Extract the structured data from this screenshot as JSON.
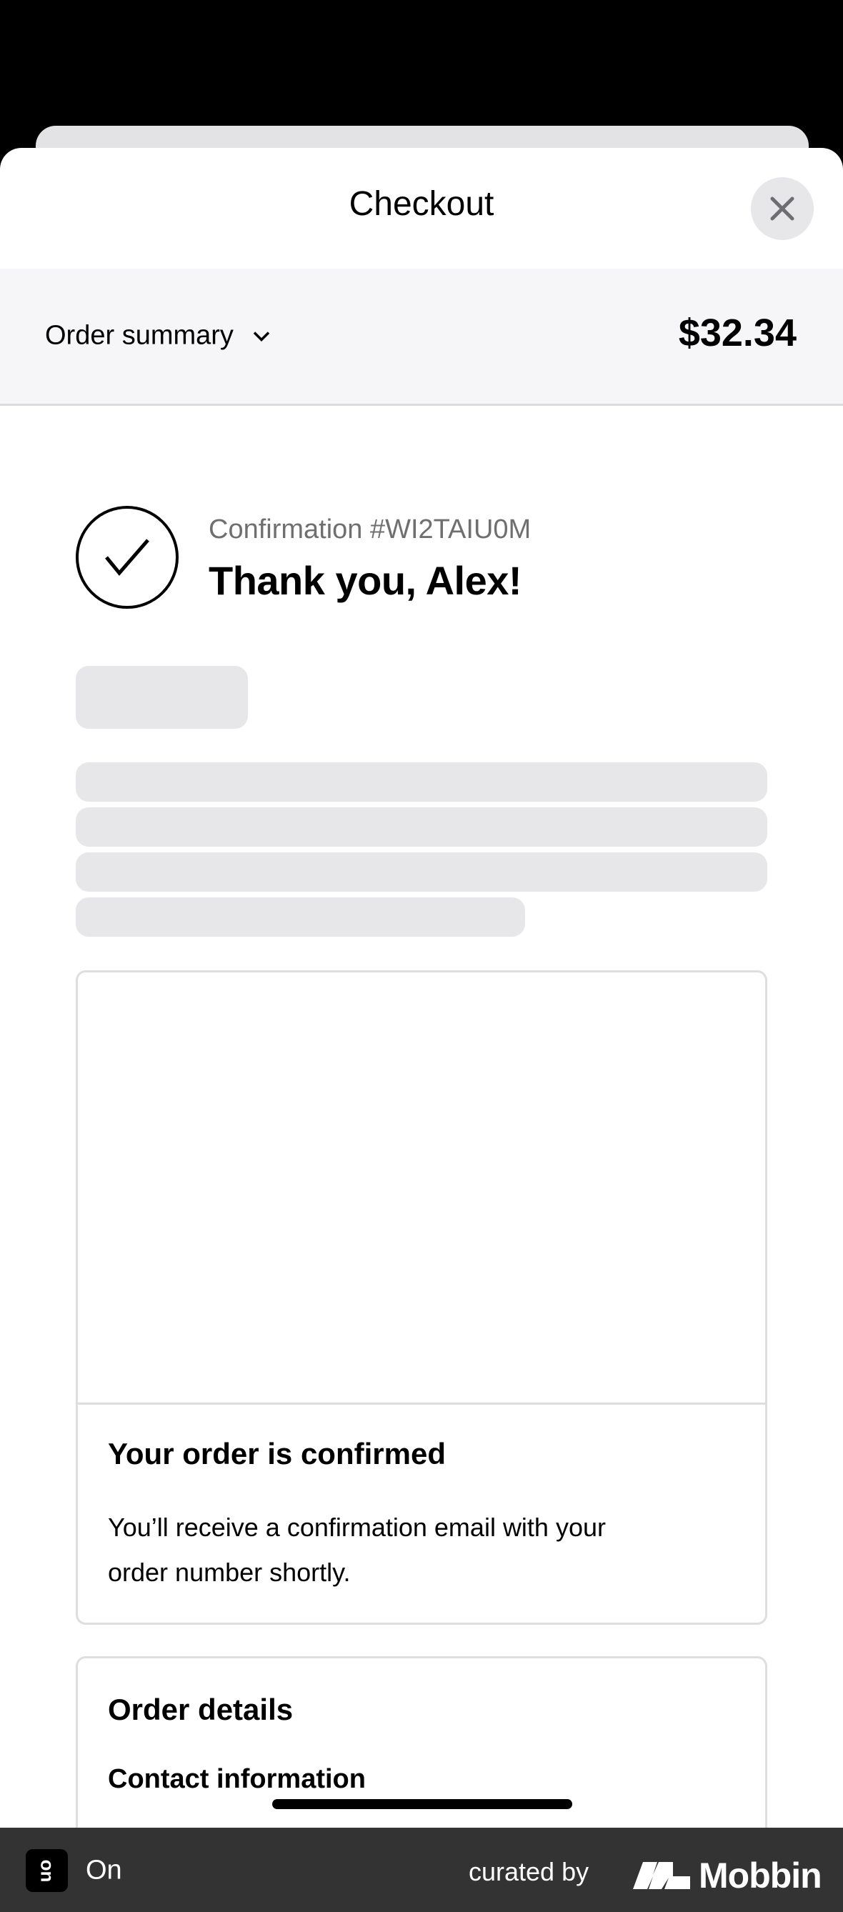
{
  "header": {
    "title": "Checkout",
    "close_icon": "close-icon"
  },
  "summary": {
    "label": "Order summary",
    "chevron_icon": "chevron-down-icon",
    "total": "$32.34"
  },
  "confirmation": {
    "number": "Confirmation #WI2TAIU0M",
    "thanks": "Thank you, Alex!",
    "icon": "check-circle-icon"
  },
  "status_card": {
    "title": "Your order is confirmed",
    "body_line1": "You’ll receive a confirmation email with your",
    "body_line2": "order number shortly."
  },
  "details_card": {
    "title": "Order details",
    "contact_heading": "Contact information"
  },
  "footer": {
    "app_name": "On",
    "curated_by": "curated by",
    "brand": "Mobbin",
    "bar_color": "#333333"
  }
}
